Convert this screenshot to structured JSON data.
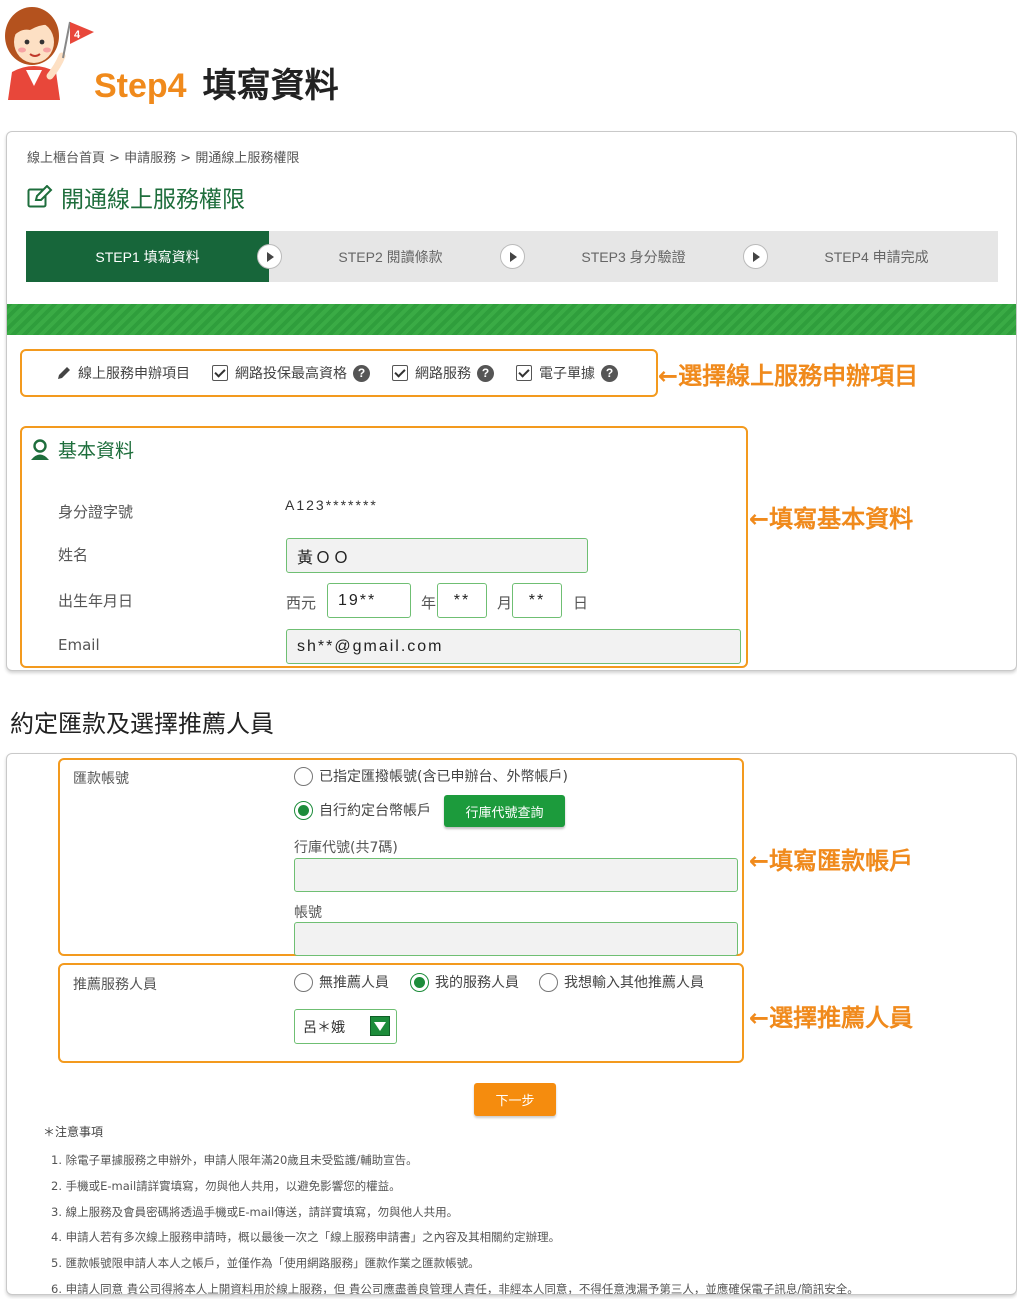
{
  "header": {
    "step_no": "Step4",
    "step_title": "填寫資料",
    "flag_number": "4"
  },
  "panel1": {
    "breadcrumb": "線上櫃台首頁 > 申請服務 > 開通線上服務權限",
    "page_title": "開通線上服務權限",
    "steps": [
      {
        "label": "STEP1 填寫資料",
        "active": true
      },
      {
        "label": "STEP2 閱讀條款",
        "active": false
      },
      {
        "label": "STEP3 身分驗證",
        "active": false
      },
      {
        "label": "STEP4 申請完成",
        "active": false
      }
    ],
    "services": {
      "label": "線上服務申辦項目",
      "items": [
        {
          "label": "網路投保最高資格",
          "checked": true
        },
        {
          "label": "網路服務",
          "checked": true
        },
        {
          "label": "電子單據",
          "checked": true
        }
      ],
      "help_glyph": "?"
    },
    "basic": {
      "title": "基本資料",
      "id_label": "身分證字號",
      "id_value": "A123*******",
      "name_label": "姓名",
      "name_value": "黃ＯＯ",
      "birth_label": "出生年月日",
      "era": "西元",
      "year": "19**",
      "year_unit": "年",
      "month": "**",
      "month_unit": "月",
      "day": "**",
      "day_unit": "日",
      "email_label": "Email",
      "email_value": "sh**@gmail.com"
    }
  },
  "callouts": {
    "services": "←選擇線上服務申辦項目",
    "basic": "←填寫基本資料",
    "account": "←填寫匯款帳戶",
    "referrer": "←選擇推薦人員"
  },
  "section_heading": "約定匯款及選擇推薦人員",
  "panel2": {
    "account": {
      "label": "匯款帳號",
      "option1": "已指定匯撥帳號(含已申辦台、外幣帳戶)",
      "option2": "自行約定台幣帳戶",
      "bank_lookup_button": "行庫代號查詢",
      "bank_code_label": "行庫代號(共7碼)",
      "account_no_label": "帳號"
    },
    "referrer": {
      "label": "推薦服務人員",
      "options": [
        "無推薦人員",
        "我的服務人員",
        "我想輸入其他推薦人員"
      ],
      "selected": 1,
      "select_value": "呂＊娥"
    },
    "next_button": "下一步",
    "notes_title": "＊注意事項",
    "notes": [
      "1. 除電子單據服務之申辦外，申請人限年滿20歲且未受監護/輔助宣告。",
      "2. 手機或E-mail請詳實填寫，勿與他人共用，以避免影響您的權益。",
      "3. 線上服務及會員密碼將透過手機或E-mail傳送，請詳實填寫，勿與他人共用。",
      "4. 申請人若有多次線上服務申請時，概以最後一次之「線上服務申請書」之內容及其相關約定辦理。",
      "5. 匯款帳號限申請人本人之帳戶，並僅作為「使用網路服務」匯款作業之匯款帳號。",
      "6. 申請人同意 貴公司得將本人上開資料用於線上服務，但 貴公司應盡善良管理人責任，非經本人同意，不得任意洩漏予第三人，並應確保電子訊息/簡訊安全。"
    ]
  },
  "colors": {
    "accent_orange": "#f08a1c",
    "brand_green": "#17663a",
    "bar_green": "#2f9e3c"
  }
}
